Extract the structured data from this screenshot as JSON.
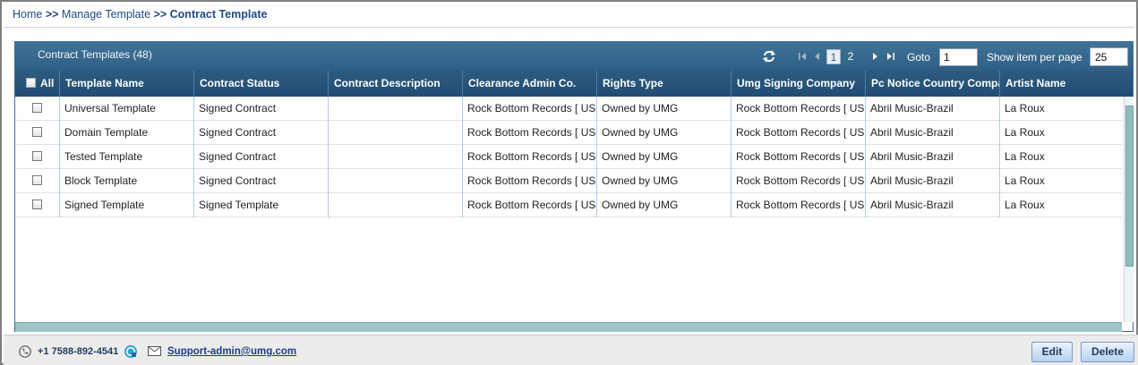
{
  "breadcrumb": {
    "home": "Home",
    "sep": ">>",
    "manage": "Manage Template",
    "current": "Contract Template"
  },
  "toolbar": {
    "title": "Contract Templates (48)",
    "pages": [
      "1",
      "2"
    ],
    "active_page": "1",
    "goto_label": "Goto",
    "goto_value": "1",
    "per_page_label": "Show item per page",
    "per_page_value": "25"
  },
  "columns": [
    "All",
    "Template Name",
    "Contract Status",
    "Contract Description",
    "Clearance Admin Co.",
    "Rights Type",
    "Umg Signing Company",
    "Pc Notice Country Company",
    "Artist Name"
  ],
  "rows": [
    [
      "Universal Template",
      "Signed Contract",
      "",
      "Rock Bottom Records [ US ]",
      "Owned by UMG",
      "Rock Bottom Records [ US ]",
      "Abril Music-Brazil",
      "La Roux"
    ],
    [
      "Domain Template",
      "Signed Contract",
      "",
      "Rock Bottom Records [ US ]",
      "Owned by UMG",
      "Rock Bottom Records [ US ]",
      "Abril Music-Brazil",
      "La Roux"
    ],
    [
      "Tested Template",
      "Signed Contract",
      "",
      "Rock Bottom Records [ US ]",
      "Owned by UMG",
      "Rock Bottom Records [ US ]",
      "Abril Music-Brazil",
      "La Roux"
    ],
    [
      "Block  Template",
      "Signed Contract",
      "",
      "Rock Bottom Records [ US ]",
      "Owned by UMG",
      "Rock Bottom Records [ US ]",
      "Abril Music-Brazil",
      "La Roux"
    ],
    [
      "Signed  Template",
      "Signed  Template",
      "",
      "Rock Bottom Records [ US ]",
      "Owned by UMG",
      "Rock Bottom Records [ US ]",
      "Abril Music-Brazil",
      "La Roux"
    ]
  ],
  "footer": {
    "phone": "+1 7588-892-4541",
    "email": "Support-admin@umg.com",
    "edit_label": "Edit",
    "delete_label": "Delete"
  },
  "icons": {
    "refresh": "refresh-icon",
    "first": "first-page-icon",
    "prev": "prev-page-icon",
    "next": "next-page-icon",
    "last": "last-page-icon",
    "phone": "phone-icon",
    "skype": "skype-icon",
    "mail": "mail-icon"
  },
  "colors": {
    "header_bg": "#2f5f85",
    "link": "#1f4a87",
    "button_bg": "#b7d2ef"
  }
}
